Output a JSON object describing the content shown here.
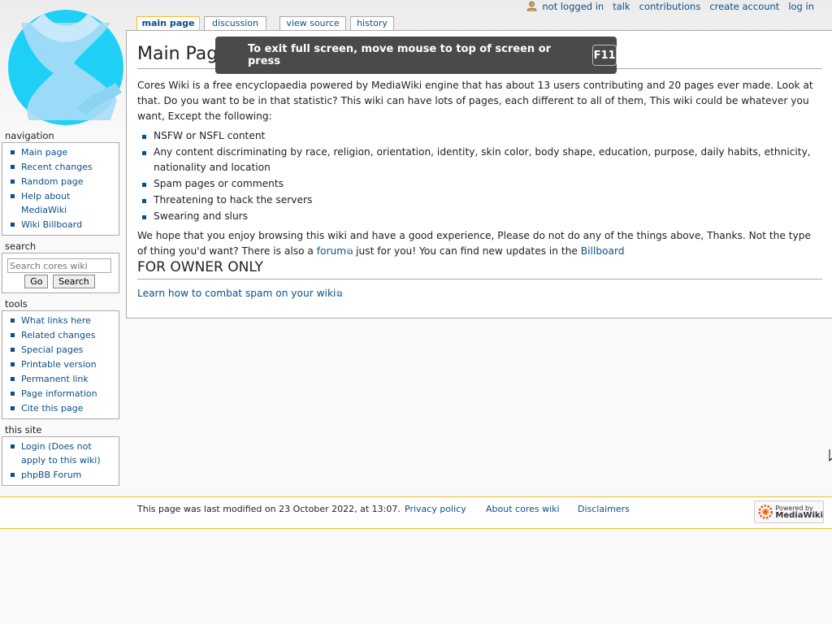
{
  "personal_tools": {
    "not_logged_in": "not logged in",
    "talk": "talk",
    "contributions": "contributions",
    "create_account": "create account",
    "log_in": "log in"
  },
  "tabs": {
    "main_page": "main page",
    "discussion": "discussion",
    "view_source": "view source",
    "history": "history"
  },
  "fullscreen_notice": {
    "text": "To exit full screen, move mouse to top of screen or press",
    "key": "F11"
  },
  "page": {
    "title": "Main Page",
    "intro": "Cores Wiki is a free encyclopaedia powered by MediaWiki engine that has about 13 users contributing and 20 pages ever made. Look at that. Do you want to be in that statistic? This wiki can have lots of pages, each different to all of them, This wiki could be whatever you want, Except the following:",
    "list": [
      "NSFW or NSFL content",
      "Any content discriminating by race, religion, orientation, identity, skin color, body shape, education, purpose, daily habits, ethnicity, nationality and location",
      "Spam pages or comments",
      "Threatening to hack the servers",
      "Swearing and slurs"
    ],
    "outro_before_forum": "We hope that you enjoy browsing this wiki and have a good experience, Please do not do any of the things above, Thanks. Not the type of thing you'd want? There is also a",
    "forum_link": "forum",
    "outro_middle": "just for you! You can find new updates in the",
    "billboard_link": "Billboard",
    "section_heading": "FOR OWNER ONLY",
    "spam_link": "Learn how to combat spam on your wiki"
  },
  "sidebar": {
    "navigation": {
      "title": "navigation",
      "items": [
        "Main page",
        "Recent changes",
        "Random page",
        "Help about MediaWiki",
        "Wiki Billboard"
      ]
    },
    "search": {
      "title": "search",
      "placeholder": "Search cores wiki",
      "go": "Go",
      "search": "Search"
    },
    "tools": {
      "title": "tools",
      "items": [
        "What links here",
        "Related changes",
        "Special pages",
        "Printable version",
        "Permanent link",
        "Page information",
        "Cite this page"
      ]
    },
    "this_site": {
      "title": "this site",
      "items": [
        "Login (Does not apply to this wiki)",
        "phpBB Forum"
      ]
    }
  },
  "footer": {
    "last_modified": "This page was last modified on 23 October 2022, at 13:07.",
    "privacy": "Privacy policy",
    "about": "About cores wiki",
    "disclaimers": "Disclaimers",
    "powered_line1": "Powered by",
    "powered_line2": "MediaWiki"
  },
  "colors": {
    "link": "#0b4f8a",
    "tab_selected_border": "#fabd23",
    "logo_blue": "#1ed0f5"
  }
}
